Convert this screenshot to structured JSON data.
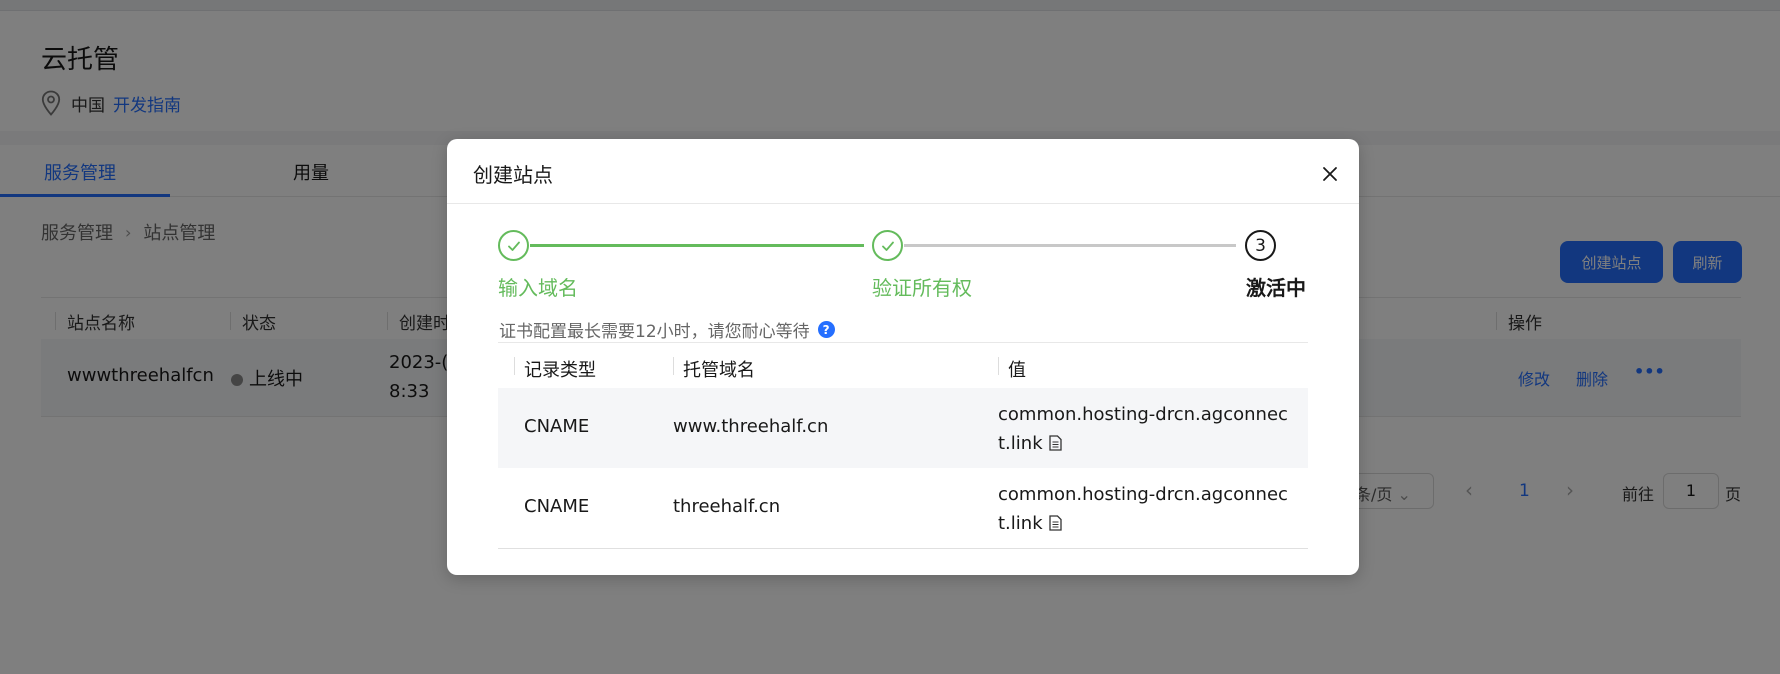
{
  "header": {
    "title": "云托管",
    "region": "中国",
    "dev_guide": "开发指南"
  },
  "tabs": [
    {
      "label": "服务管理",
      "active": true
    },
    {
      "label": "用量",
      "active": false
    }
  ],
  "breadcrumb": [
    "服务管理",
    "站点管理"
  ],
  "toolbar": {
    "create_label": "创建站点",
    "refresh_label": "刷新"
  },
  "table": {
    "columns": [
      "站点名称",
      "状态",
      "创建时",
      "操作"
    ],
    "rows": [
      {
        "name": "wwwthreehalfcn",
        "status": "上线中",
        "created_line1": "2023-(",
        "created_line2": "8:33",
        "edit": "修改",
        "delete": "删除",
        "more": "•••"
      }
    ]
  },
  "pagination": {
    "per_page": "条/页",
    "current": "1",
    "goto_label": "前往",
    "goto_value": "1",
    "page_unit": "页"
  },
  "modal": {
    "title": "创建站点",
    "steps": [
      {
        "label": "输入域名",
        "state": "done"
      },
      {
        "label": "验证所有权",
        "state": "done"
      },
      {
        "label": "激活中",
        "number": "3",
        "state": "current"
      }
    ],
    "hint": "证书配置最长需要12小时，请您耐心等待",
    "hint_icon": "?",
    "table": {
      "columns": [
        "记录类型",
        "托管域名",
        "值"
      ],
      "rows": [
        {
          "type": "CNAME",
          "domain": "www.threehalf.cn",
          "value": "common.hosting-drcn.agconnect.link"
        },
        {
          "type": "CNAME",
          "domain": "threehalf.cn",
          "value": "common.hosting-drcn.agconnect.link"
        }
      ]
    }
  },
  "colors": {
    "primary": "#256fff",
    "success": "#64bb5c",
    "overlay": "rgba(0,0,0,0.5)"
  }
}
